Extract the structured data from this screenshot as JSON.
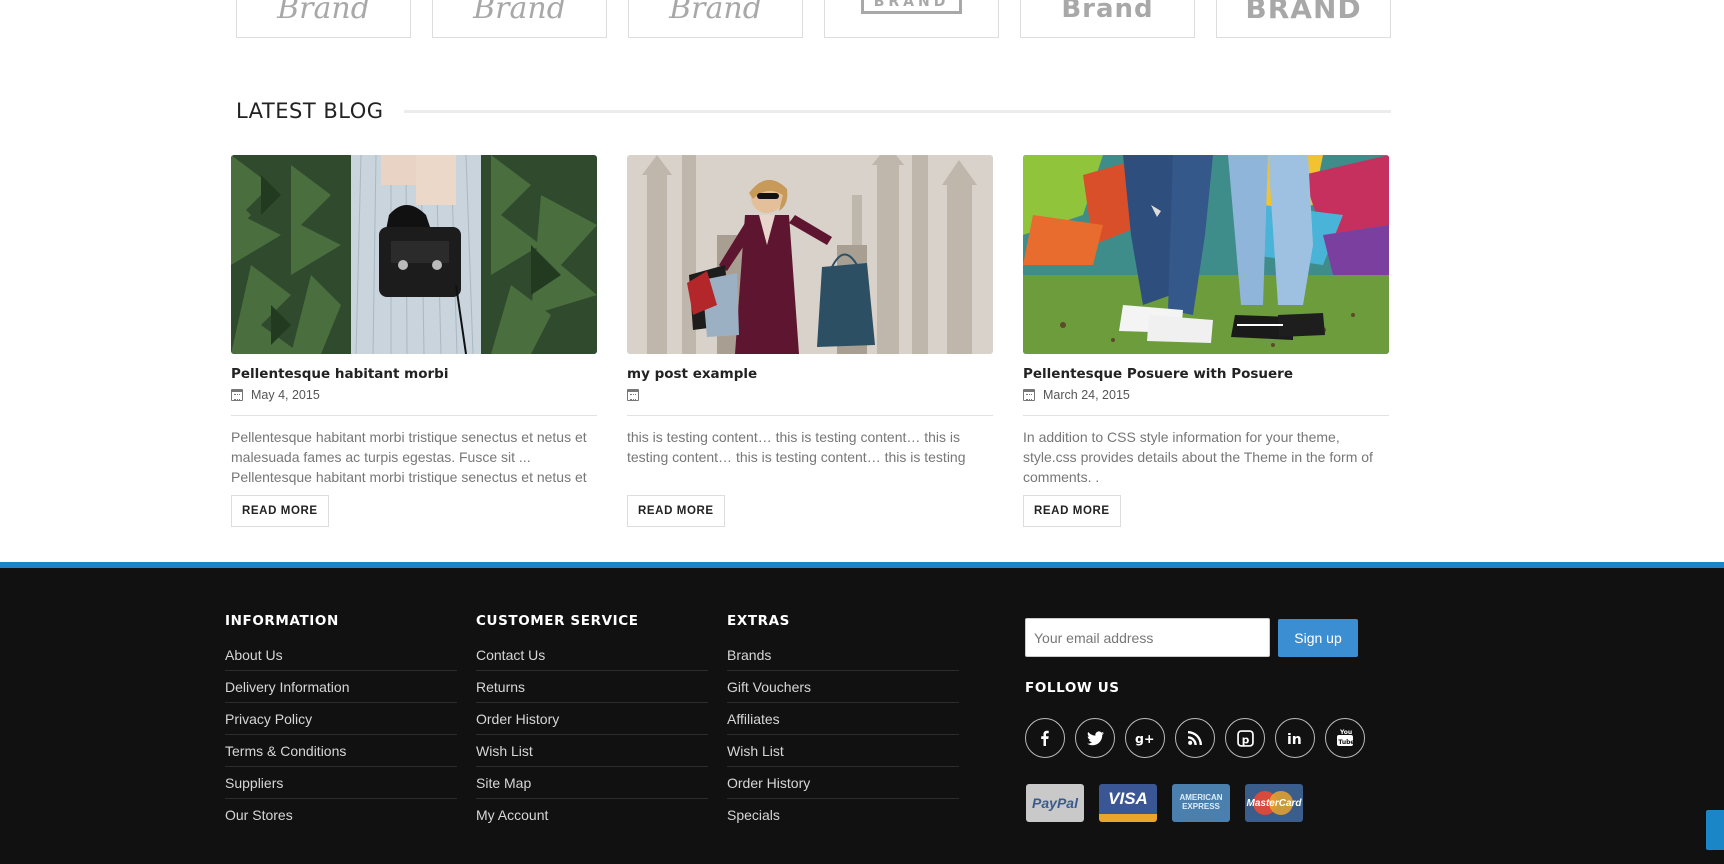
{
  "brands": [
    {
      "text": "Brand",
      "style": "italic"
    },
    {
      "text": "Brand",
      "style": "italic"
    },
    {
      "text": "Brand",
      "style": "italic"
    },
    {
      "text": "BRAND",
      "style": "boxed"
    },
    {
      "text": "Brand",
      "style": "bold"
    },
    {
      "text": "BRAND",
      "style": "bold"
    }
  ],
  "blog": {
    "title": "LATEST BLOG",
    "posts": [
      {
        "title": "Pellentesque habitant morbi",
        "date": "May 4, 2015",
        "excerpt": "Pellentesque habitant morbi tristique senectus et netus et malesuada fames ac turpis egestas. Fusce sit ... Pellentesque habitant morbi tristique senectus et netus et",
        "button": "READ MORE"
      },
      {
        "title": "my post example",
        "date": "",
        "excerpt": "this is testing content… this is testing content… this is testing content… this is testing content… this is testing",
        "button": "READ MORE"
      },
      {
        "title": "Pellentesque Posuere with Posuere",
        "date": "March 24, 2015",
        "excerpt": "In addition to CSS style information for your theme, style.css provides details about the Theme in the form of comments. .",
        "button": "READ MORE"
      }
    ]
  },
  "footer": {
    "columns": [
      {
        "title": "INFORMATION",
        "links": [
          "About Us",
          "Delivery Information",
          "Privacy Policy",
          "Terms & Conditions",
          "Suppliers",
          "Our Stores"
        ]
      },
      {
        "title": "CUSTOMER SERVICE",
        "links": [
          "Contact Us",
          "Returns",
          "Order History",
          "Wish List",
          "Site Map",
          "My Account"
        ]
      },
      {
        "title": "EXTRAS",
        "links": [
          "Brands",
          "Gift Vouchers",
          "Affiliates",
          "Wish List",
          "Order History",
          "Specials"
        ]
      }
    ],
    "newsletter": {
      "placeholder": "Your email address",
      "button": "Sign up"
    },
    "follow_title": "FOLLOW US",
    "socials": [
      "facebook-icon",
      "twitter-icon",
      "google-plus-icon",
      "rss-icon",
      "pinterest-icon",
      "linkedin-icon",
      "youtube-icon"
    ],
    "payments": [
      {
        "name": "paypal",
        "label": "PayPal"
      },
      {
        "name": "visa",
        "label": "VISA"
      },
      {
        "name": "amex",
        "label": "AMERICAN EXPRESS"
      },
      {
        "name": "mastercard",
        "label": "MasterCard"
      }
    ],
    "accent": "#1a86c8",
    "button_color": "#3c8ed2"
  }
}
